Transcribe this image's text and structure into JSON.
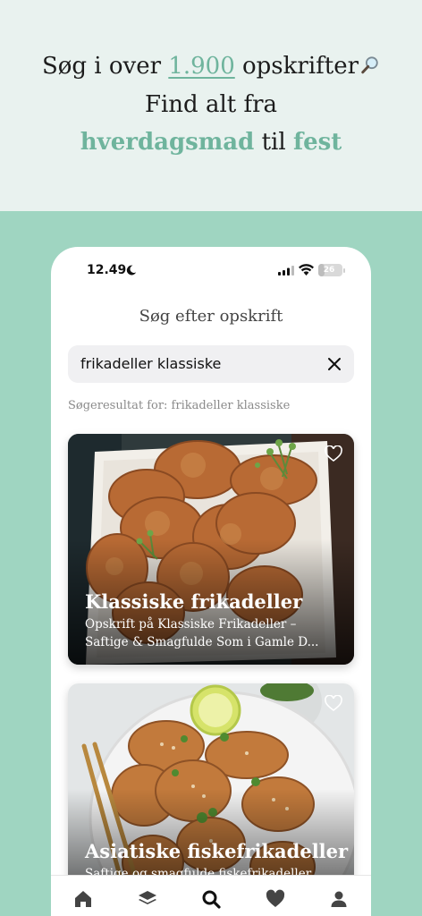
{
  "promo": {
    "line1_a": "Søg i over ",
    "line1_count": "1.900",
    "line1_b": " opskrifter",
    "line2": "Find alt fra",
    "line3_a": "hverdagsmad",
    "line3_b": " til ",
    "line3_c": "fest",
    "accent_color": "#6fb49d",
    "icon": "magnifying-glass-icon"
  },
  "status_bar": {
    "time": "12.49",
    "battery": "26",
    "battery_level": 0.26,
    "icons": [
      "moon-icon",
      "signal-icon",
      "wifi-icon",
      "battery-icon"
    ]
  },
  "screen": {
    "title": "Søg efter opskrift",
    "search": {
      "value": "frikadeller klassiske",
      "clear_icon": "close-icon"
    },
    "result_label": "Søgeresultat for: frikadeller klassiske"
  },
  "results": [
    {
      "title": "Klassiske frikadeller",
      "desc_line1": "Opskrift på Klassiske Frikadeller –",
      "desc_line2": "Saftige & Smagfulde Som i Gamle D...",
      "favorite_icon": "heart-outline-icon"
    },
    {
      "title": "Asiatiske fiskefrikadeller",
      "desc_line1": "Saftige og smagfulde fiskefrikadeller",
      "desc_line2": "",
      "favorite_icon": "heart-outline-icon"
    }
  ],
  "tab_bar": {
    "tabs": [
      "home-icon",
      "layers-icon",
      "search-icon",
      "heart-icon",
      "profile-icon"
    ],
    "active": "search-icon"
  },
  "colors": {
    "background_top": "#e9f2ef",
    "background_mint": "#9fd5c1",
    "accent": "#6fb49d"
  }
}
